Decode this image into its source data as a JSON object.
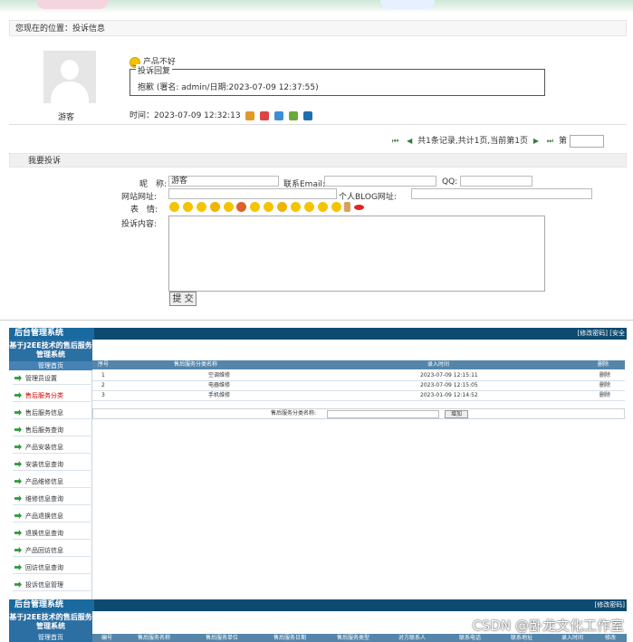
{
  "location": {
    "text": "您现在的位置：投诉信息"
  },
  "complaint": {
    "emoji_icon": "smile-icon",
    "title": "产品不好",
    "reply_legend": "投诉回复",
    "reply_text": "抱歉 (署名: admin/日期:2023-07-09 12:37:55)",
    "username": "游客",
    "time_label": "时间：2023-07-09 12:32:13"
  },
  "pager": {
    "first": "⏮",
    "prev": "◀",
    "info": "共1条记录,共计1页,当前第1页",
    "next": "▶",
    "last": "⏭",
    "goto_label": "第"
  },
  "form": {
    "section_title": "我要投诉",
    "nickname_label": "昵　称:",
    "nickname_value": "游客",
    "email_label": "联系Email:",
    "qq_label": "QQ:",
    "homepage_label": "网站网址:",
    "blog_label": "个人BLOG网址:",
    "expression_label": "表　情:",
    "content_label": "投诉内容:",
    "submit_label": "提 交"
  },
  "admin": {
    "logo": "后台管理系统",
    "top_right": "[修改密码] [安全",
    "side_title": "基于J2EE技术的售后服务管理系统",
    "home": "管理首页",
    "menu": [
      "管理员设置",
      "售后服务分类",
      "售后服务信息",
      "售后服务查询",
      "产品安装信息",
      "安装信息查询",
      "产品维修信息",
      "维修信息查询",
      "产品退换信息",
      "退换信息查询",
      "产品回访信息",
      "回访信息查询",
      "投诉信息管理"
    ],
    "active_index": 1,
    "columns": [
      "序号",
      "售后服务分类名称",
      "录入时间",
      "删除"
    ],
    "rows": [
      {
        "no": "1",
        "name": "空调维修",
        "time": "2023-07-09 12:15:11",
        "del": "删除"
      },
      {
        "no": "2",
        "name": "电器维修",
        "time": "2023-07-09 12:15:05",
        "del": "删除"
      },
      {
        "no": "3",
        "name": "手机维修",
        "time": "2023-01-09 12:14:52",
        "del": "删除"
      }
    ],
    "add_label": "售后服务分类名称:",
    "add_button": "增加"
  },
  "admin2": {
    "logo": "后台管理系统",
    "top_right": "[修改密码]",
    "side_title": "基于J2EE技术的售后服务管理系统",
    "home": "管理首页",
    "columns": [
      "编号",
      "售后服务名称",
      "售后服务单位",
      "售后服务日期",
      "售后服务类型",
      "对方联系人",
      "联系电话",
      "联系地址",
      "录入时间",
      "修改"
    ]
  },
  "watermark": "CSDN @卧龙文化工作室"
}
